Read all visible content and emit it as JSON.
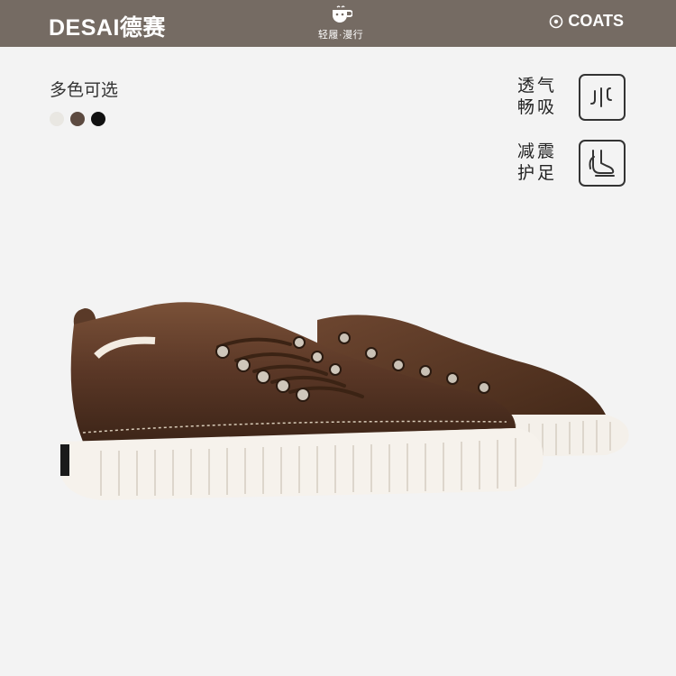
{
  "header": {
    "brand": "DESAI德赛",
    "slogan": "轻履·漫行",
    "partner": "COATS",
    "icons": [
      "cup-logo-icon",
      "coats-logo-icon"
    ]
  },
  "colors": {
    "label": "多色可选",
    "options": [
      "#e9e7e2",
      "#5c4a40",
      "#111111"
    ]
  },
  "features": [
    {
      "line1": "透气",
      "line2": "畅吸",
      "icon": "breathable-airflow-icon"
    },
    {
      "line1": "减震",
      "line2": "护足",
      "icon": "foot-cushion-icon"
    }
  ],
  "product": {
    "image": "brown-leather-sneakers",
    "color": "#5b3a28"
  }
}
